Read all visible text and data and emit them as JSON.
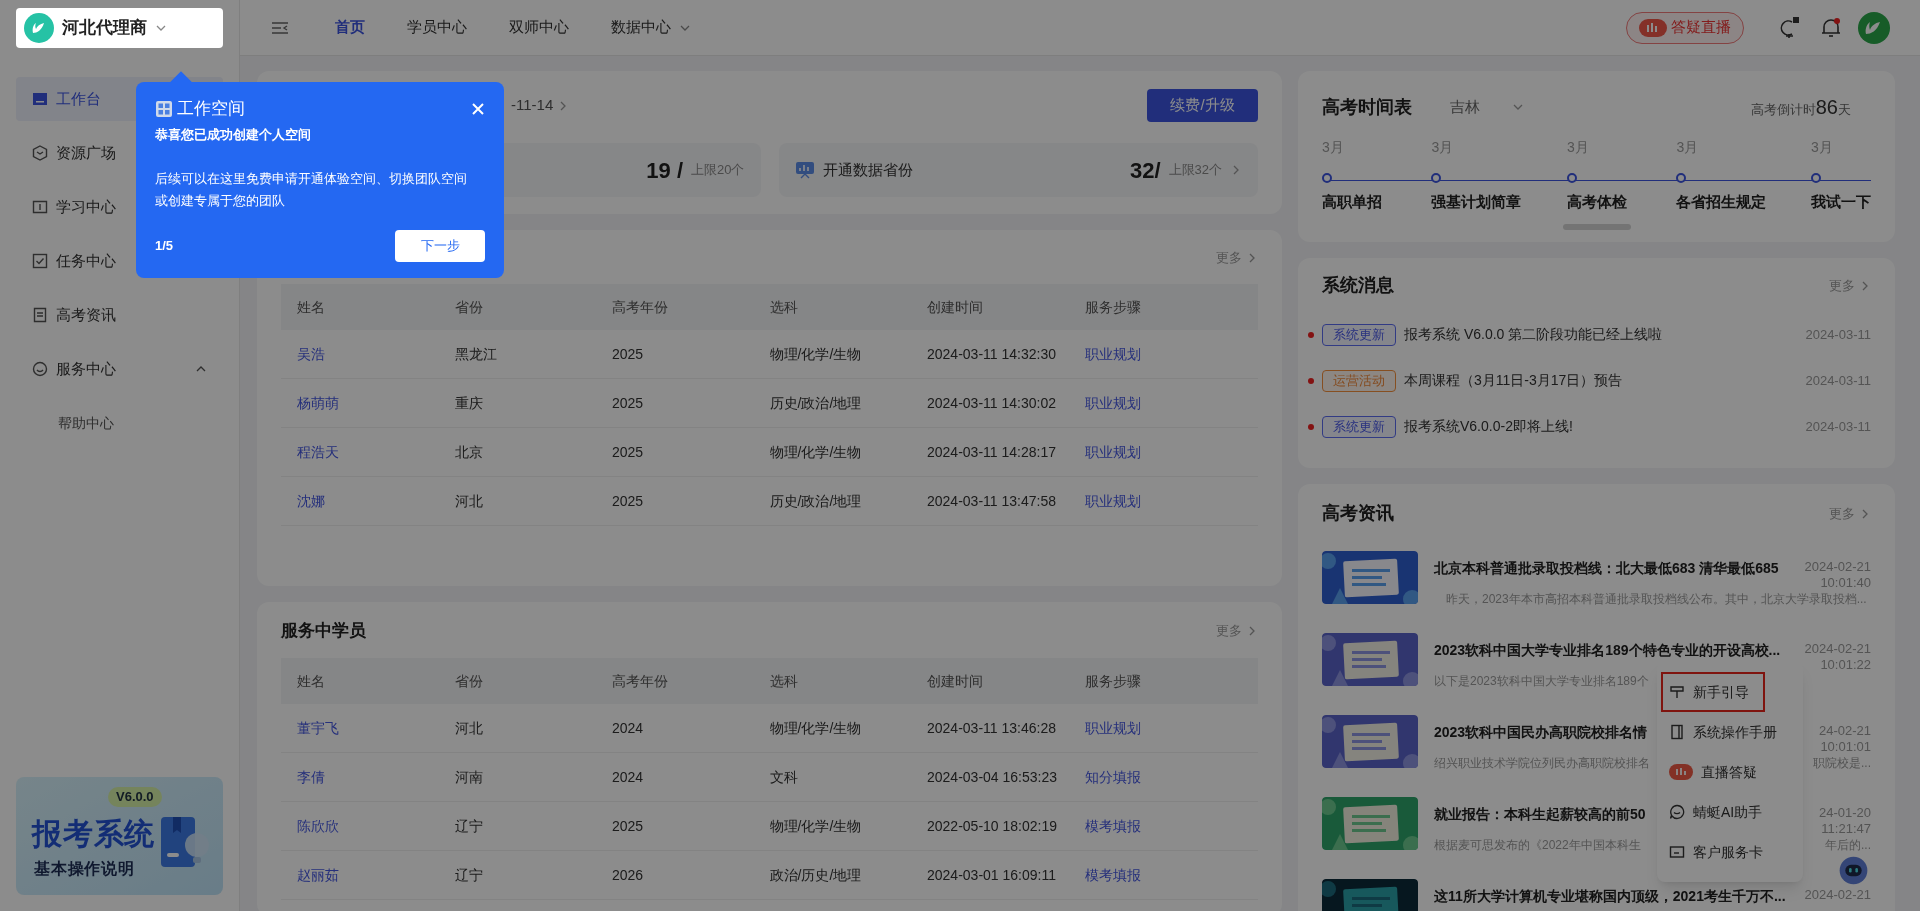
{
  "workspace": {
    "name": "河北代理商"
  },
  "guide_popover": {
    "title": "工作空间",
    "message": "恭喜您已成功创建个人空间",
    "description": "后续可以在这里免费申请开通体验空间、切换团队空间或创建专属于您的团队",
    "step": "1/5",
    "next_button": "下一步"
  },
  "sidebar": {
    "items": [
      {
        "label": "工作台",
        "selected": true
      },
      {
        "label": "资源广场",
        "selected": false
      },
      {
        "label": "学习中心",
        "selected": false
      },
      {
        "label": "任务中心",
        "selected": false
      },
      {
        "label": "高考资讯",
        "selected": false
      },
      {
        "label": "服务中心",
        "selected": false,
        "expanded": true,
        "children": [
          {
            "label": "帮助中心",
            "selected": false
          }
        ]
      }
    ]
  },
  "banner": {
    "version": "V6.0.0",
    "title": "报考系统",
    "subtitle": "基本操作说明"
  },
  "nav": {
    "tabs": [
      {
        "label": "首页",
        "selected": true,
        "has_menu": false
      },
      {
        "label": "学员中心",
        "selected": false,
        "has_menu": false
      },
      {
        "label": "双师中心",
        "selected": false,
        "has_menu": false
      },
      {
        "label": "数据中心",
        "selected": false,
        "has_menu": true
      }
    ]
  },
  "header": {
    "live_button": "答疑直播"
  },
  "subscription": {
    "date": "-11-14",
    "renew_button": "续费/升级",
    "stats": [
      {
        "value": "19 /",
        "limit": "上限20个",
        "link": false
      },
      {
        "label": "开通数据省份",
        "value": "32/",
        "limit": "上限32个",
        "link": true
      }
    ]
  },
  "recent_students": {
    "more": "更多",
    "columns": [
      "姓名",
      "省份",
      "高考年份",
      "选科",
      "创建时间",
      "服务步骤"
    ],
    "rows": [
      {
        "name": "吴浩",
        "province": "黑龙江",
        "year": "2025",
        "subjects": "物理/化学/生物",
        "created": "2024-03-11 14:32:30",
        "step": "职业规划"
      },
      {
        "name": "杨萌萌",
        "province": "重庆",
        "year": "2025",
        "subjects": "历史/政治/地理",
        "created": "2024-03-11 14:30:02",
        "step": "职业规划"
      },
      {
        "name": "程浩天",
        "province": "北京",
        "year": "2025",
        "subjects": "物理/化学/生物",
        "created": "2024-03-11 14:28:17",
        "step": "职业规划"
      },
      {
        "name": "沈娜",
        "province": "河北",
        "year": "2025",
        "subjects": "历史/政治/地理",
        "created": "2024-03-11 13:47:58",
        "step": "职业规划"
      }
    ]
  },
  "serving_students": {
    "title": "服务中学员",
    "more": "更多",
    "columns": [
      "姓名",
      "省份",
      "高考年份",
      "选科",
      "创建时间",
      "服务步骤"
    ],
    "rows": [
      {
        "name": "董宇飞",
        "province": "河北",
        "year": "2024",
        "subjects": "物理/化学/生物",
        "created": "2024-03-11 13:46:28",
        "step": "职业规划"
      },
      {
        "name": "李倩",
        "province": "河南",
        "year": "2024",
        "subjects": "文科",
        "created": "2024-03-04 16:53:23",
        "step": "知分填报"
      },
      {
        "name": "陈欣欣",
        "province": "辽宁",
        "year": "2025",
        "subjects": "物理/化学/生物",
        "created": "2022-05-10 18:02:19",
        "step": "模考填报"
      },
      {
        "name": "赵丽茹",
        "province": "辽宁",
        "year": "2026",
        "subjects": "政治/历史/地理",
        "created": "2024-03-01 16:09:11",
        "step": "模考填报"
      }
    ]
  },
  "exam_timeline": {
    "title": "高考时间表",
    "region": "吉林",
    "countdown_label": "高考倒计时",
    "countdown_value": "86",
    "countdown_unit": "天",
    "events": [
      {
        "month": "3月",
        "label": "高职单招"
      },
      {
        "month": "3月",
        "label": "强基计划简章"
      },
      {
        "month": "3月",
        "label": "高考体检"
      },
      {
        "month": "3月",
        "label": "各省招生规定"
      },
      {
        "month": "3月",
        "label": "我试一下"
      }
    ]
  },
  "system_messages": {
    "title": "系统消息",
    "more": "更多",
    "items": [
      {
        "tag": "系统更新",
        "kind": "update",
        "text": "报考系统 V6.0.0 第二阶段功能已经上线啦",
        "date": "2024-03-11",
        "unread": true
      },
      {
        "tag": "运营活动",
        "kind": "activity",
        "text": "本周课程（3月11日-3月17日）预告",
        "date": "2024-03-11",
        "unread": true
      },
      {
        "tag": "系统更新",
        "kind": "update",
        "text": "报考系统V6.0.0-2即将上线!",
        "date": "2024-03-11",
        "unread": true
      }
    ]
  },
  "news": {
    "title": "高考资讯",
    "more": "更多",
    "items": [
      {
        "title": "北京本科普通批录取投档线：北大最低683 清华最低685",
        "summary": "昨天，2023年本市高招本科普通批录取投档线公布。其中，北京大学录取投档...",
        "date": "2024-02-21",
        "time": "10:01:40"
      },
      {
        "title": "2023软科中国大学专业排名189个特色专业的开设高校...",
        "summary": "以下是2023软科中国大学专业排名189个",
        "date": "2024-02-21",
        "time": "10:01:22"
      },
      {
        "title": "2023软科中国民办高职院校排名情",
        "summary": "绍兴职业技术学院位列民办高职院校排名",
        "summary_end": "职院校是...",
        "date": "24-02-21",
        "time": "10:01:01"
      },
      {
        "title": "就业报告：本科生起薪较高的前50",
        "summary": "根据麦可思发布的《2022年中国本科生",
        "summary_end": "年后的...",
        "date": "24-01-20",
        "time": "11:21:47"
      },
      {
        "title": "这11所大学计算机专业堪称国内顶级，2021考生千万不...",
        "date": "2024-02-21"
      }
    ]
  },
  "help_menu": {
    "items": [
      {
        "label": "新手引导",
        "highlighted": true
      },
      {
        "label": "系统操作手册",
        "highlighted": false
      },
      {
        "label": "直播答疑",
        "highlighted": false
      },
      {
        "label": "蜻蜓AI助手",
        "highlighted": false
      },
      {
        "label": "客户服务卡",
        "highlighted": false
      }
    ]
  }
}
